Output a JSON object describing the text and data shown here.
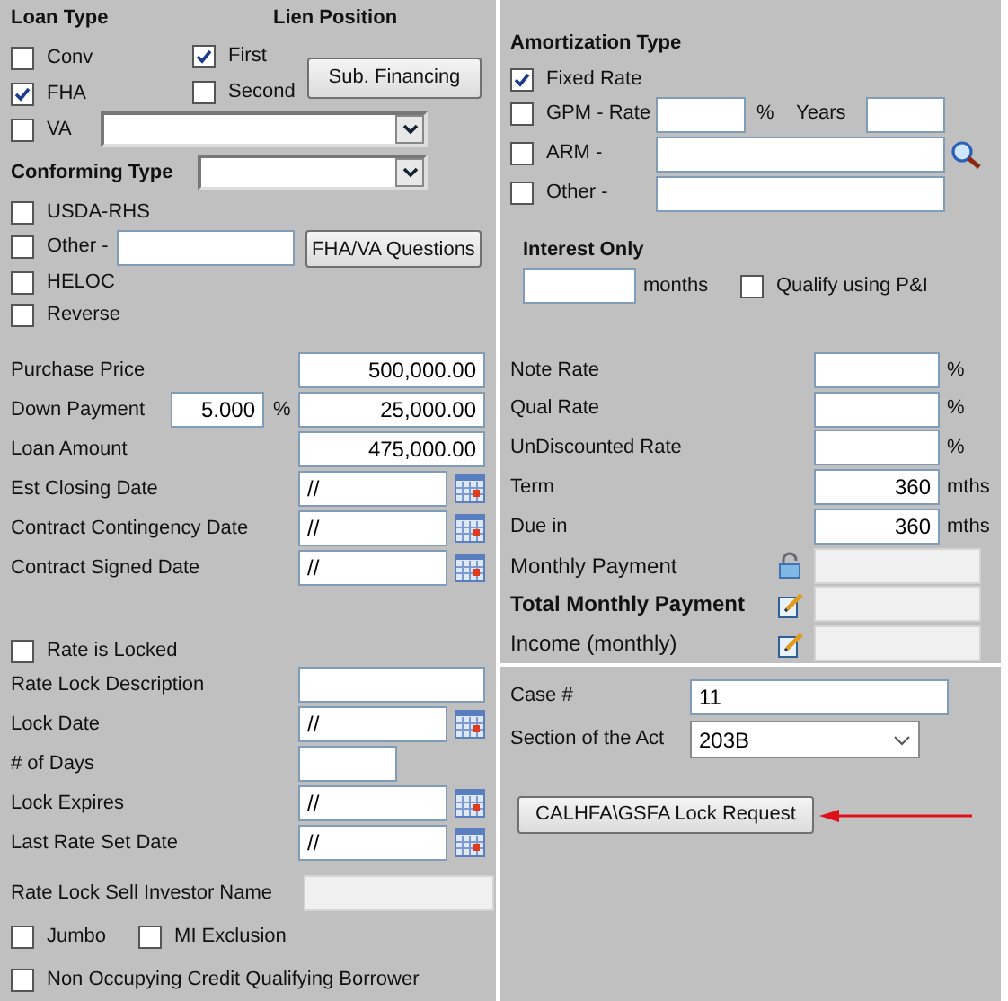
{
  "loan_type": {
    "title": "Loan Type",
    "options": [
      {
        "label": "Conv",
        "checked": false
      },
      {
        "label": "FHA",
        "checked": true
      },
      {
        "label": "VA",
        "checked": false
      }
    ]
  },
  "lien_position": {
    "title": "Lien Position",
    "options": [
      {
        "label": "First",
        "checked": true
      },
      {
        "label": "Second",
        "checked": false
      }
    ],
    "button": "Sub. Financing"
  },
  "conforming_type": {
    "label": "Conforming Type"
  },
  "other_types": [
    {
      "label": "USDA-RHS",
      "checked": false,
      "kind": "plain"
    },
    {
      "label": "Other -",
      "checked": false,
      "kind": "field"
    },
    {
      "label": "HELOC",
      "checked": false,
      "kind": "plain"
    },
    {
      "label": "Reverse",
      "checked": false,
      "kind": "plain"
    }
  ],
  "fha_va_button": "FHA/VA Questions",
  "amortization": {
    "title": "Amortization Type",
    "options": [
      {
        "label": "Fixed Rate",
        "checked": true,
        "kind": "plain"
      },
      {
        "label": "GPM - Rate",
        "checked": false,
        "kind": "gpm",
        "unit": "%",
        "years_label": "Years"
      },
      {
        "label": "ARM -",
        "checked": false,
        "kind": "search"
      },
      {
        "label": "Other -",
        "checked": false,
        "kind": "field"
      }
    ]
  },
  "interest_only": {
    "title": "Interest Only",
    "unit": "months",
    "qualify": {
      "label": "Qualify using P&I",
      "checked": false
    }
  },
  "loan_fields": [
    {
      "label": "Purchase Price",
      "kind": "amount",
      "value": "500,000.00"
    },
    {
      "label": "Down Payment",
      "kind": "percent_amount",
      "percent": "5.000",
      "unit": "%",
      "value": "25,000.00"
    },
    {
      "label": "Loan Amount",
      "kind": "amount",
      "value": "475,000.00"
    },
    {
      "label": "Est Closing Date",
      "kind": "date",
      "value": "//"
    },
    {
      "label": "Contract Contingency Date",
      "kind": "date",
      "value": "//"
    },
    {
      "label": "Contract Signed Date",
      "kind": "date",
      "value": "//"
    }
  ],
  "rate_lock": {
    "locked": {
      "label": "Rate is Locked",
      "checked": false
    },
    "fields": [
      {
        "label": "Rate Lock Description",
        "kind": "text"
      },
      {
        "label": "Lock Date",
        "kind": "date",
        "value": "//"
      },
      {
        "label": "# of Days",
        "kind": "short"
      },
      {
        "label": "Lock Expires",
        "kind": "date",
        "value": "//"
      },
      {
        "label": "Last Rate Set Date",
        "kind": "date",
        "value": "//"
      },
      {
        "label": "Rate Lock Sell Investor Name",
        "kind": "disabled"
      }
    ]
  },
  "flags": [
    {
      "label": "Jumbo",
      "checked": false
    },
    {
      "label": "MI Exclusion",
      "checked": false
    }
  ],
  "non_occupying": {
    "label": "Non Occupying Credit Qualifying Borrower",
    "checked": false
  },
  "rates": [
    {
      "label": "Note Rate",
      "kind": "input",
      "unit": "%"
    },
    {
      "label": "Qual Rate",
      "kind": "input",
      "unit": "%"
    },
    {
      "label": "UnDiscounted Rate",
      "kind": "input",
      "unit": "%"
    },
    {
      "label": "Term",
      "kind": "input",
      "value": "360",
      "unit": "mths"
    },
    {
      "label": "Due in",
      "kind": "input",
      "value": "360",
      "unit": "mths"
    },
    {
      "label": "Monthly Payment",
      "kind": "locked",
      "bold": false
    },
    {
      "label": "Total Monthly Payment",
      "kind": "edit",
      "bold": true
    },
    {
      "label": "Income (monthly)",
      "kind": "edit",
      "bold": false
    }
  ],
  "case": {
    "label": "Case #",
    "value": "11"
  },
  "section_of_act": {
    "label": "Section of the Act",
    "value": "203B"
  },
  "lock_request_button": "CALHFA\\GSFA Lock Request"
}
